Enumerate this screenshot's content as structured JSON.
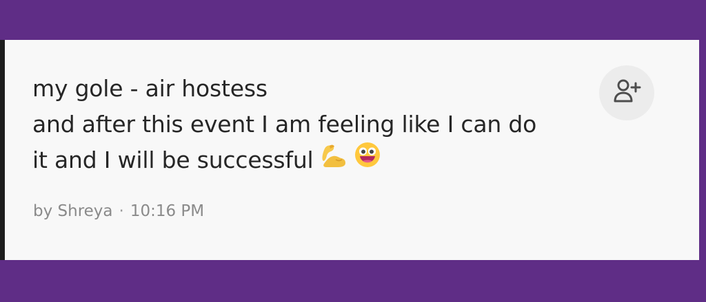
{
  "note": {
    "lines": [
      "my gole - air hostess",
      "and after this event I am feeling like I can do",
      "it and I will be successful"
    ],
    "emojis": [
      "flexed-biceps-icon",
      "grinning-face-icon"
    ]
  },
  "meta": {
    "author": "by Shreya",
    "separator": "·",
    "time": "10:16 PM"
  },
  "actions": {
    "add_user_icon": "add-user-icon"
  },
  "colors": {
    "brand_purple": "#5f2d86",
    "card_background": "#f8f8f8",
    "text_primary": "#262626",
    "text_secondary": "#8a8a8a",
    "button_background": "#ececec"
  }
}
